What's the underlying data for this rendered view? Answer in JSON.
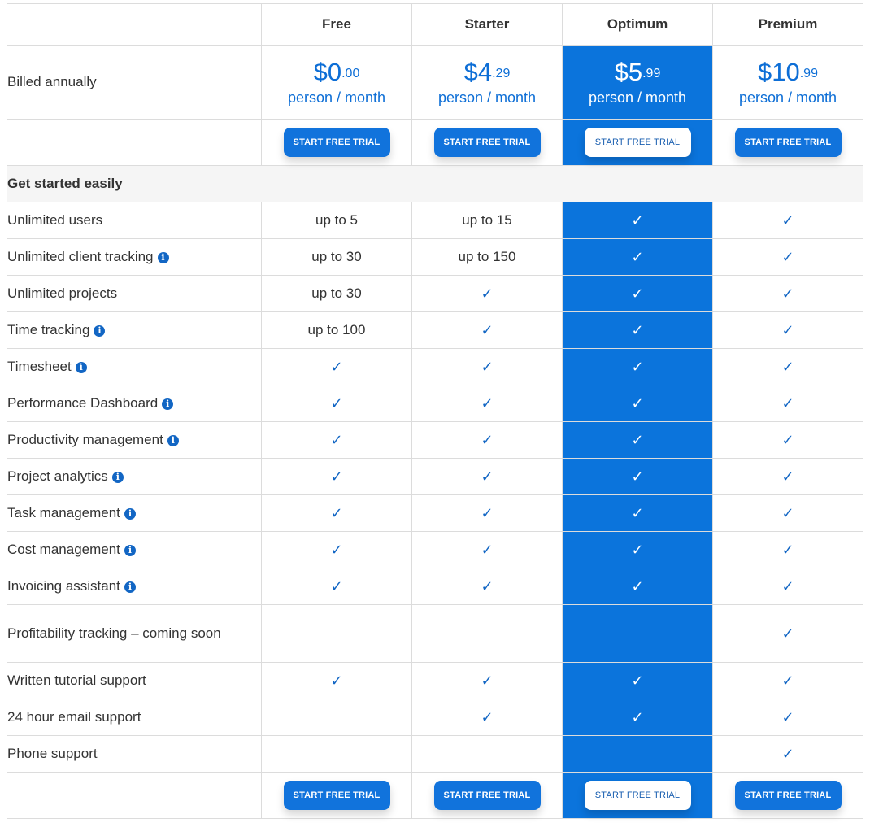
{
  "plans": [
    {
      "name": "Free",
      "price_main": "$0",
      "price_cents": ".00",
      "period": "person / month"
    },
    {
      "name": "Starter",
      "price_main": "$4",
      "price_cents": ".29",
      "period": "person / month"
    },
    {
      "name": "Optimum",
      "price_main": "$5",
      "price_cents": ".99",
      "period": "person / month"
    },
    {
      "name": "Premium",
      "price_main": "$10",
      "price_cents": ".99",
      "period": "person / month"
    }
  ],
  "billing_label": "Billed annually",
  "cta_label": "START FREE TRIAL",
  "section_title": "Get started easily",
  "check_glyph": "✓",
  "info_glyph": "i",
  "features": [
    {
      "label": "Unlimited users",
      "info": false,
      "values": [
        "up to 5",
        "up to 15",
        "✓",
        "✓"
      ]
    },
    {
      "label": "Unlimited client tracking",
      "info": true,
      "values": [
        "up to 30",
        "up to 150",
        "✓",
        "✓"
      ]
    },
    {
      "label": "Unlimited projects",
      "info": false,
      "values": [
        "up to 30",
        "✓",
        "✓",
        "✓"
      ]
    },
    {
      "label": "Time tracking",
      "info": true,
      "values": [
        "up to 100",
        "✓",
        "✓",
        "✓"
      ]
    },
    {
      "label": "Timesheet",
      "info": true,
      "values": [
        "✓",
        "✓",
        "✓",
        "✓"
      ]
    },
    {
      "label": "Performance Dashboard",
      "info": true,
      "values": [
        "✓",
        "✓",
        "✓",
        "✓"
      ]
    },
    {
      "label": "Productivity management",
      "info": true,
      "values": [
        "✓",
        "✓",
        "✓",
        "✓"
      ]
    },
    {
      "label": "Project analytics",
      "info": true,
      "values": [
        "✓",
        "✓",
        "✓",
        "✓"
      ]
    },
    {
      "label": "Task management",
      "info": true,
      "values": [
        "✓",
        "✓",
        "✓",
        "✓"
      ]
    },
    {
      "label": "Cost management",
      "info": true,
      "values": [
        "✓",
        "✓",
        "✓",
        "✓"
      ]
    },
    {
      "label": "Invoicing assistant",
      "info": true,
      "values": [
        "✓",
        "✓",
        "✓",
        "✓"
      ]
    },
    {
      "label": "Profitability tracking – coming soon",
      "info": false,
      "values": [
        "",
        "",
        "",
        "✓"
      ]
    },
    {
      "label": "Written tutorial support",
      "info": false,
      "values": [
        "✓",
        "✓",
        "✓",
        "✓"
      ]
    },
    {
      "label": "24 hour email support",
      "info": false,
      "values": [
        "",
        "✓",
        "✓",
        "✓"
      ]
    },
    {
      "label": "Phone support",
      "info": false,
      "values": [
        "",
        "",
        "",
        "✓"
      ]
    }
  ],
  "colors": {
    "accent": "#0b74dc",
    "text_blue": "#0d6ed6"
  }
}
